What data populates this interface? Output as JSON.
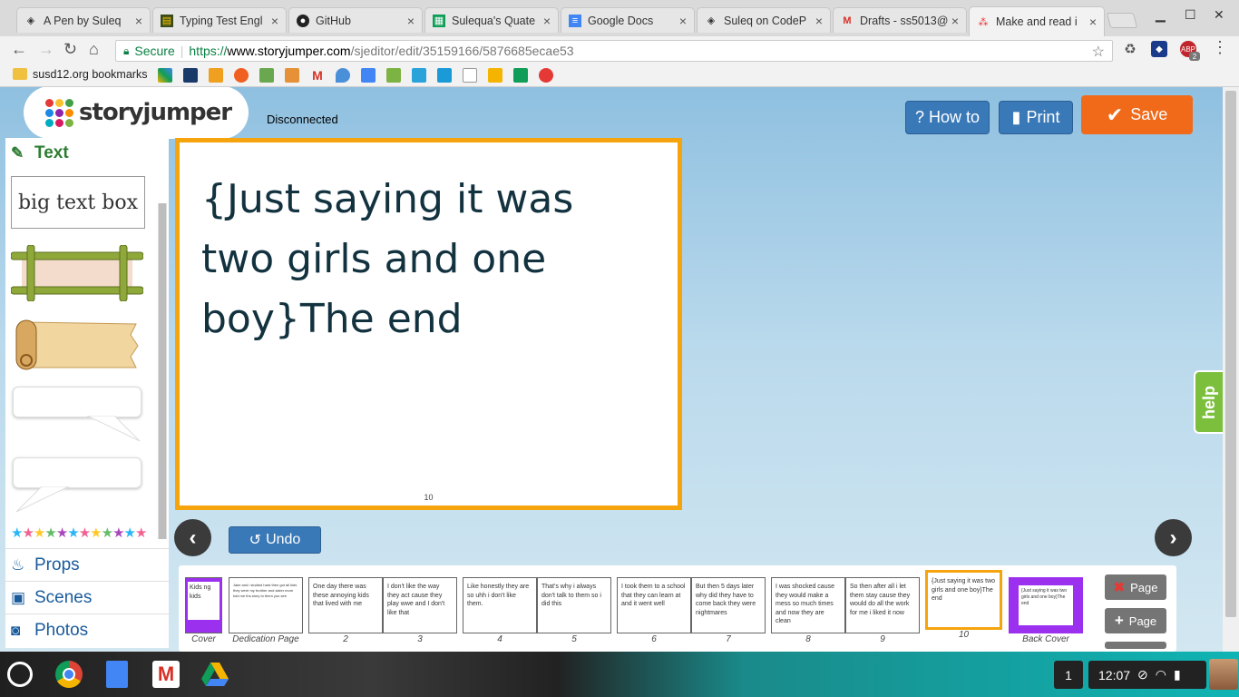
{
  "browser": {
    "tabs": [
      {
        "title": "A Pen by Suleq",
        "icon": "codepen-icon"
      },
      {
        "title": "Typing Test Engl",
        "icon": "typing-icon"
      },
      {
        "title": "GitHub",
        "icon": "github-icon"
      },
      {
        "title": "Sulequa's Quate",
        "icon": "sheets-icon"
      },
      {
        "title": "Google Docs",
        "icon": "docs-icon"
      },
      {
        "title": "Suleq on CodeP",
        "icon": "codepen-icon"
      },
      {
        "title": "Drafts - ss5013@",
        "icon": "gmail-icon"
      },
      {
        "title": "Make and read i",
        "icon": "storyjumper-icon"
      }
    ],
    "secure_label": "Secure",
    "url_scheme": "https://",
    "url_host": "www.storyjumper.com",
    "url_path": "/sjeditor/edit/35159166/5876685ecae53",
    "bookmarks_label": "susd12.org bookmarks",
    "abp_label": "ABP",
    "abp_badge": "2"
  },
  "app": {
    "logo_text": "storyjumper",
    "status": "Disconnected",
    "howto_label": "? How to",
    "print_label": "Print",
    "save_label": "Save",
    "undo_label": "Undo",
    "help_label": "help",
    "colors": {
      "accent_orange": "#f06a1a",
      "button_blue": "#3a79b8",
      "selection": "#f5a40d",
      "help_green": "#7cbf3c"
    }
  },
  "sidebar": {
    "active_section": "Text",
    "big_text_box": "big text box",
    "sections": [
      "Props",
      "Scenes",
      "Photos"
    ]
  },
  "editor": {
    "page_text": "{Just saying it was two girls and one boy}The end",
    "page_number": "10"
  },
  "pages": [
    {
      "caption": "Cover",
      "text": "Kids ng kids",
      "style": "purple-half"
    },
    {
      "caption": "Dedication Page",
      "text": "Jake and i studied hard then got all kids they were my brother and sister mom told me ths story to them you see",
      "style": "normal"
    },
    {
      "caption": "2",
      "text": "One day there was these annoying kids that lived with me",
      "style": "left"
    },
    {
      "caption": "3",
      "text": "I don't like the way they act cause they play wwe and I don't like that",
      "style": "right"
    },
    {
      "caption": "4",
      "text": "Like honestly they are so uhh i don't like them.",
      "style": "left"
    },
    {
      "caption": "5",
      "text": "That's why i always don't talk to them so i did this",
      "style": "right"
    },
    {
      "caption": "6",
      "text": "I took them to a school that they can learn at and it went well",
      "style": "left"
    },
    {
      "caption": "7",
      "text": "But then 5 days later why did they have to come back they were nightmares",
      "style": "right"
    },
    {
      "caption": "8",
      "text": "I was shocked cause they would make a mess so much times and now they are clean",
      "style": "left"
    },
    {
      "caption": "9",
      "text": "So then after all i let them stay cause they would do all the work for me i liked it now",
      "style": "right"
    },
    {
      "caption": "10",
      "text": "{Just saying it was two girls and one boy}The end",
      "style": "selected"
    },
    {
      "caption": "Back Cover",
      "text": "{Just saying it was two girls and one boy}The end",
      "style": "purple"
    }
  ],
  "page_buttons": {
    "remove": "Page",
    "add": "Page"
  },
  "shelf": {
    "notification_count": "1",
    "time": "12:07"
  }
}
